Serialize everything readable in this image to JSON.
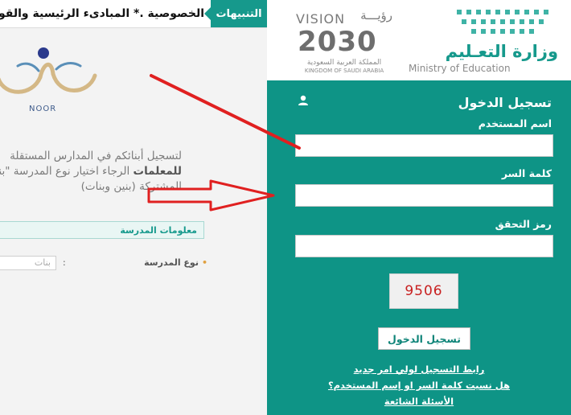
{
  "notice_bar": {
    "tab_label": "التنبيهات",
    "text": "الخصوصية .* المبادىء الرئيسية والقواعد"
  },
  "noor_logo": {
    "label": "NOOR"
  },
  "intro": {
    "line1": "لتسجيل أبنائكم في المدارس المستقلة",
    "line2_bold": "للمعلمات",
    "line2_rest": " الرجاء اختيار نوع المدرسة \"بنات\"",
    "line3": "المشتركة (بنين وبنات)"
  },
  "school_info": {
    "title": "معلومات المدرسة",
    "type_label": "نوع المدرسة",
    "colon": ":",
    "type_value": "بنات"
  },
  "vision2030": {
    "vision_text": "VISION",
    "vision_ar": "رؤيـــة",
    "number": "2030",
    "country_ar": "المملكة العربية السعودية",
    "country_en": "KINGDOM OF SAUDI ARABIA"
  },
  "ministry": {
    "name_ar": "وزارة التعـليم",
    "name_en": "Ministry of Education"
  },
  "login": {
    "title": "تسجيل الدخول",
    "username_label": "اسم المستخدم",
    "password_label": "كلمة السر",
    "captcha_label": "رمز التحقق",
    "captcha_text": "9506",
    "submit_label": "تسجيل الدخول",
    "links": {
      "parent_register": "رابط التسجيل لولي امر جديد",
      "forgot": "هل نسيت كلمة السر او إسم المستخدم؟",
      "faq": "الأسئلة الشائعة"
    }
  },
  "colors": {
    "brand_teal": "#0e9486",
    "arrow_red": "#e02020"
  }
}
